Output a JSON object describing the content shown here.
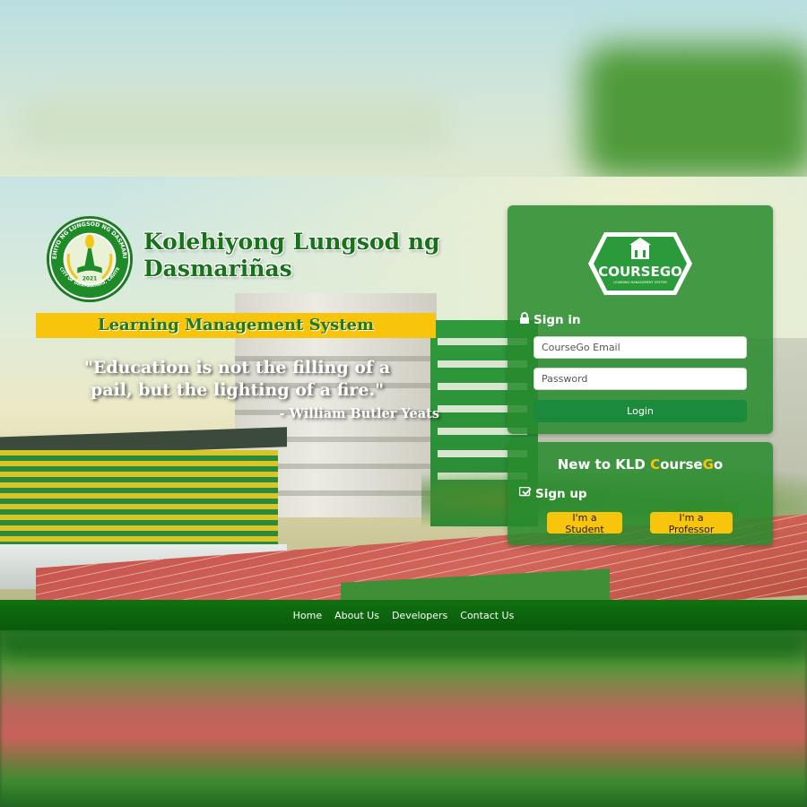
{
  "school": {
    "name": "Kolehiyong Lungsod ng Dasmariñas",
    "seal_ring_text": "KOLEHIYO NG LUNGSOD NG DASMARIÑAS",
    "seal_bottom_text": "CITY OF DASMARIÑAS, CAVITE",
    "seal_year": "2021"
  },
  "banner": {
    "title": "Learning Management System"
  },
  "quote": {
    "text": "\"Education is not the filling of a pail, but the lighting of a fire.\"",
    "author": "- William Butler Yeats"
  },
  "login": {
    "logo_text": "COURSEGO",
    "logo_subtitle": "LEARNING MANAGEMENT SYSTEM",
    "signin_label": "Sign in",
    "email_placeholder": "CourseGo Email",
    "password_placeholder": "Password",
    "login_button": "Login"
  },
  "signup": {
    "heading_prefix": "New to KLD ",
    "heading_c": "C",
    "heading_mid": "ourse",
    "heading_g": "G",
    "heading_end": "o",
    "signup_label": "Sign up",
    "student_button": "I'm a Student",
    "professor_button": "I'm a Professor"
  },
  "footer": {
    "links": [
      "Home",
      "About Us",
      "Developers",
      "Contact Us"
    ]
  },
  "colors": {
    "brand_green": "#17721a",
    "accent_yellow": "#f9c40c",
    "card_green": "#288a2c",
    "login_button": "#1b8a3c",
    "footer_green": "#0a5a0a"
  },
  "icons": {
    "signin": "lock-icon",
    "signup": "signup-icon"
  }
}
